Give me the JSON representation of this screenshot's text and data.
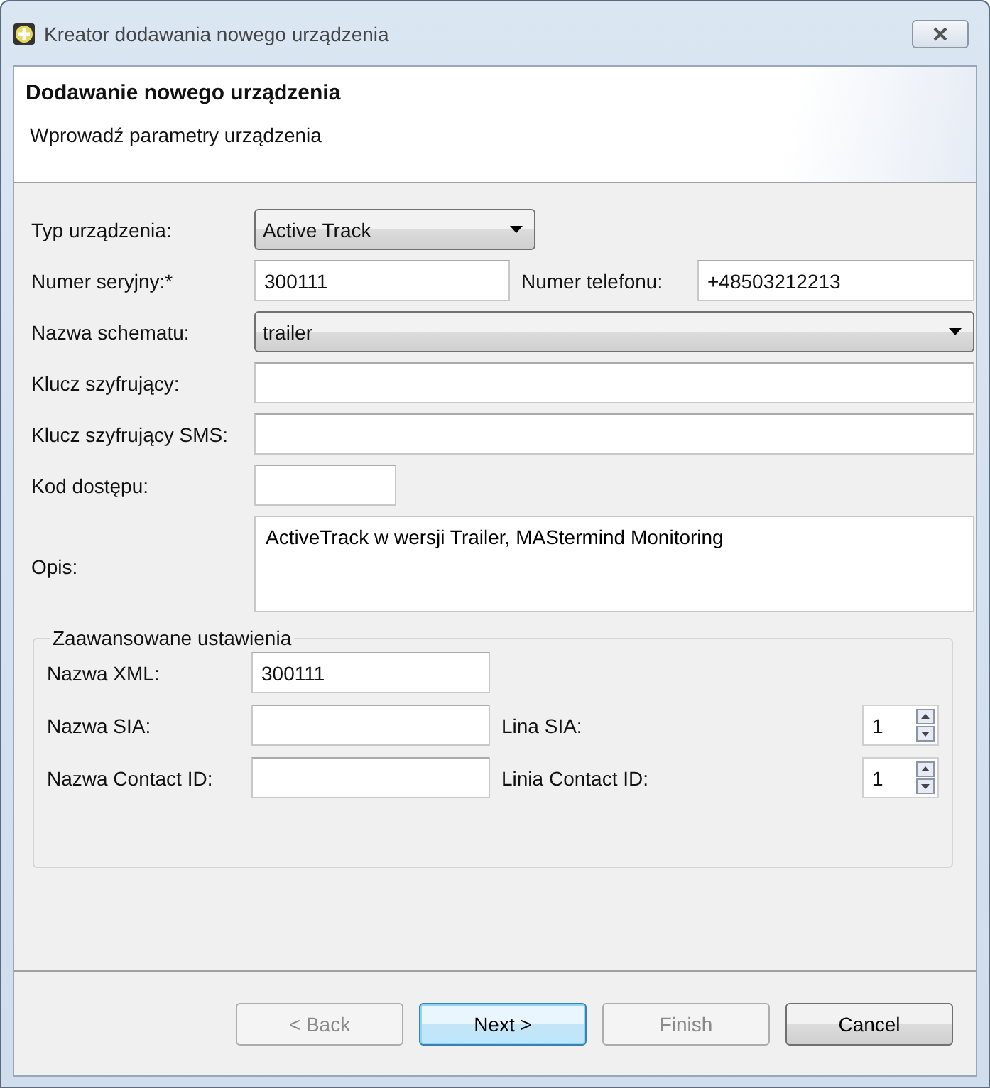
{
  "window": {
    "title": "Kreator dodawania nowego urządzenia"
  },
  "header": {
    "title": "Dodawanie nowego urządzenia",
    "subtitle": "Wprowadź parametry urządzenia"
  },
  "form": {
    "device_type": {
      "label": "Typ urządzenia:",
      "value": "Active Track"
    },
    "serial_number": {
      "label": "Numer seryjny:*",
      "value": "300111"
    },
    "phone_number": {
      "label": "Numer telefonu:",
      "value": "+48503212213"
    },
    "schema_name": {
      "label": "Nazwa schematu:",
      "value": "trailer"
    },
    "encryption_key": {
      "label": "Klucz szyfrujący:"
    },
    "sms_encryption_key": {
      "label": "Klucz szyfrujący SMS:"
    },
    "access_code": {
      "label": "Kod dostępu:"
    },
    "description": {
      "label": "Opis:",
      "value": "ActiveTrack w wersji Trailer, MAStermind Monitoring"
    }
  },
  "advanced": {
    "title": "Zaawansowane ustawienia",
    "xml_name": {
      "label": "Nazwa XML:",
      "value": "300111"
    },
    "sia_name": {
      "label": "Nazwa SIA:"
    },
    "sia_line": {
      "label": "Lina SIA:",
      "value": "1"
    },
    "contact_id_name": {
      "label": "Nazwa Contact ID:"
    },
    "contact_id_line": {
      "label": "Linia Contact ID:",
      "value": "1"
    }
  },
  "buttons": [
    {
      "label": "< Back",
      "disabled": true,
      "default": false
    },
    {
      "label": "Next >",
      "disabled": false,
      "default": true
    },
    {
      "label": "Finish",
      "disabled": true,
      "default": false
    },
    {
      "label": "Cancel",
      "disabled": false,
      "default": false
    }
  ]
}
